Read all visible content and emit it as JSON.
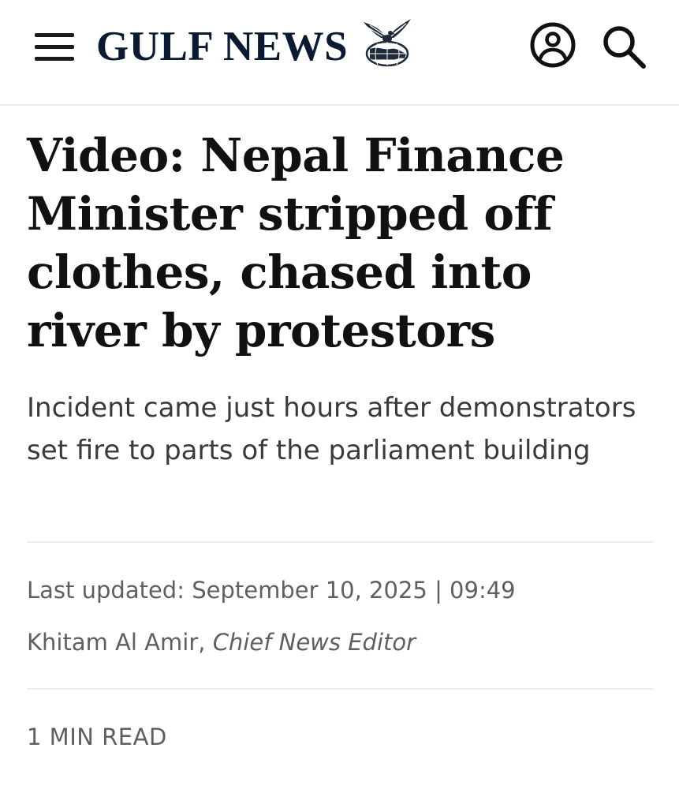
{
  "header": {
    "brand": "GULF NEWS",
    "icons": {
      "menu": "menu-icon",
      "emblem": "eagle-globe-icon",
      "account": "user-account-icon",
      "search": "search-icon"
    },
    "brand_color": "#0a1a33"
  },
  "article": {
    "headline": "Video: Nepal Finance Minister stripped off clothes, chased into river by protestors",
    "subheadline": "Incident came just hours after demonstrators set fire to parts of the parliament building",
    "last_updated_label": "Last updated:",
    "last_updated_value": "September 10, 2025 | 09:49",
    "author_name": "Khitam Al Amir",
    "author_separator": ",",
    "author_role": "Chief News Editor",
    "read_time": "1 MIN READ"
  }
}
